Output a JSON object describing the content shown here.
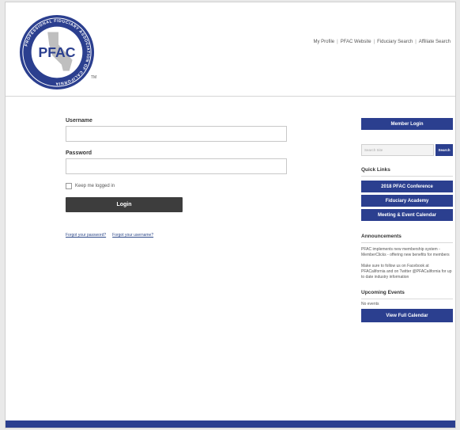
{
  "header": {
    "logo_text": "PFAC",
    "logo_ring_text": "PROFESSIONAL FIDUCIARY ASSOCIATION OF CALIFORNIA",
    "tm": "TM",
    "nav": [
      "My Profile",
      "PFAC Website",
      "Fiduciary Search",
      "Affiliate Search"
    ]
  },
  "login": {
    "username_label": "Username",
    "password_label": "Password",
    "remember_label": "Keep me logged in",
    "login_button": "Login",
    "forgot_password": "Forgot your password?",
    "forgot_username": "Forgot your username?"
  },
  "sidebar": {
    "member_login": "Member Login",
    "search_placeholder": "Search Site",
    "search_button": "Search",
    "quick_links_title": "Quick Links",
    "quick_links": [
      "2018 PFAC Conference",
      "Fiduciary Academy",
      "Meeting & Event Calendar"
    ],
    "announcements_title": "Announcements",
    "announcement_1": "PFAC implements new membership system - MemberClicks - offering new benefits for members",
    "announcement_2": "Make sure to follow us on Facebook at PFACalifornia and on Twitter @PFACalifornia for up to date industry information",
    "upcoming_title": "Upcoming Events",
    "no_events": "No events",
    "calendar_button": "View Full Calendar"
  },
  "colors": {
    "brand_blue": "#2b3f8f",
    "dark_button": "#3d3d3d"
  }
}
